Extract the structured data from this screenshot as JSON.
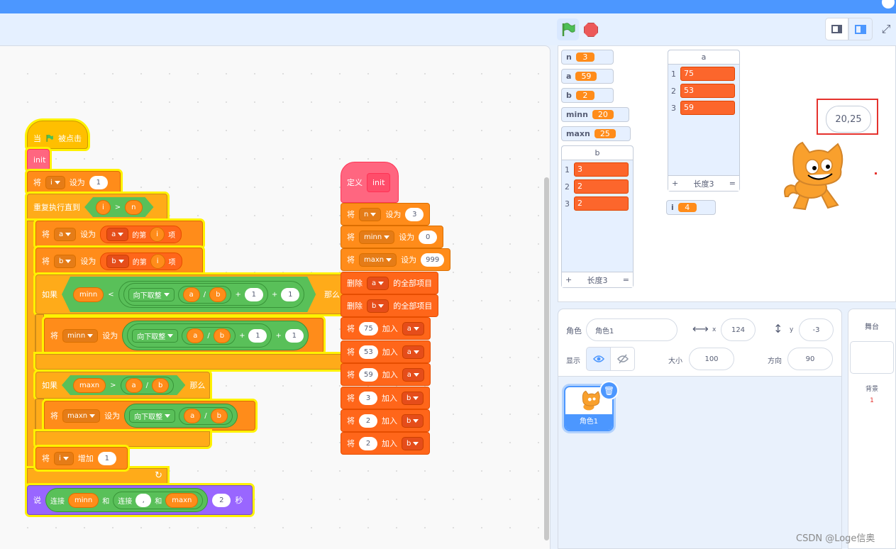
{
  "controls": {
    "green_flag": "green-flag-icon",
    "stop": "stop-icon"
  },
  "colors": {
    "accent": "#4c97ff",
    "events": "#ffbf00",
    "control": "#ffab19",
    "variables": "#ff8c1a",
    "lists": "#ff661a",
    "operators": "#59c059",
    "custom": "#ff6680",
    "looks": "#9966ff"
  },
  "script_main": {
    "hat": {
      "when": "当",
      "clicked": "被点击"
    },
    "init_call": "init",
    "set_i": {
      "verb": "将",
      "var": "i",
      "to": "设为",
      "value": "1"
    },
    "repeat": {
      "label": "重复执行直到",
      "left": "i",
      "op": ">",
      "right": "n"
    },
    "set_a": {
      "verb": "将",
      "var": "a",
      "to": "设为",
      "list": "a",
      "item_of": "的第",
      "index": "i",
      "item": "项"
    },
    "set_b": {
      "verb": "将",
      "var": "b",
      "to": "设为",
      "list": "b",
      "item_of": "的第",
      "index": "i",
      "item": "项"
    },
    "if1": {
      "label": "如果",
      "left": "minn",
      "op": "<",
      "floor": "向下取整",
      "a": "a",
      "div": "/",
      "b": "b",
      "plus1": "+",
      "one1": "1",
      "plus2": "+",
      "one2": "1",
      "then": "那么"
    },
    "set_minn": {
      "verb": "将",
      "var": "minn",
      "to": "设为",
      "floor": "向下取整",
      "a": "a",
      "div": "/",
      "b": "b",
      "plus1": "+",
      "one1": "1",
      "plus2": "+",
      "one2": "1"
    },
    "if2": {
      "label": "如果",
      "left": "maxn",
      "op": ">",
      "a": "a",
      "div": "/",
      "b": "b",
      "then": "那么"
    },
    "set_maxn": {
      "verb": "将",
      "var": "maxn",
      "to": "设为",
      "floor": "向下取整",
      "a": "a",
      "div": "/",
      "b": "b"
    },
    "change_i": {
      "verb": "将",
      "var": "i",
      "by": "增加",
      "value": "1"
    },
    "say": {
      "label": "说",
      "join1": "连接",
      "minn": "minn",
      "and1": "和",
      "join2": "连接",
      "comma": ",",
      "and2": "和",
      "maxn": "maxn",
      "secs": "2",
      "unit": "秒"
    }
  },
  "script_init": {
    "define": "定义",
    "name": "init",
    "rows": [
      {
        "verb": "将",
        "var": "n",
        "to": "设为",
        "value": "3"
      },
      {
        "verb": "将",
        "var": "minn",
        "to": "设为",
        "value": "0"
      },
      {
        "verb": "将",
        "var": "maxn",
        "to": "设为",
        "value": "999"
      },
      {
        "verb": "删除",
        "list": "a",
        "suffix": "的全部项目"
      },
      {
        "verb": "删除",
        "list": "b",
        "suffix": "的全部项目"
      },
      {
        "verb": "将",
        "value": "75",
        "add": "加入",
        "list": "a"
      },
      {
        "verb": "将",
        "value": "53",
        "add": "加入",
        "list": "a"
      },
      {
        "verb": "将",
        "value": "59",
        "add": "加入",
        "list": "a"
      },
      {
        "verb": "将",
        "value": "3",
        "add": "加入",
        "list": "b"
      },
      {
        "verb": "将",
        "value": "2",
        "add": "加入",
        "list": "b"
      },
      {
        "verb": "将",
        "value": "2",
        "add": "加入",
        "list": "b"
      }
    ]
  },
  "stage": {
    "monitors": [
      {
        "name": "n",
        "value": "3"
      },
      {
        "name": "a",
        "value": "59"
      },
      {
        "name": "b",
        "value": "2"
      },
      {
        "name": "minn",
        "value": "20"
      },
      {
        "name": "maxn",
        "value": "25"
      },
      {
        "name": "i",
        "value": "4"
      }
    ],
    "list_a": {
      "title": "a",
      "items": [
        "75",
        "53",
        "59"
      ],
      "indices": [
        "1",
        "2",
        "3"
      ],
      "add": "+",
      "length": "长度3",
      "resize": "="
    },
    "list_b": {
      "title": "b",
      "items": [
        "3",
        "2",
        "2"
      ],
      "indices": [
        "1",
        "2",
        "3"
      ],
      "add": "+",
      "length": "长度3",
      "resize": "="
    },
    "speech": "20,25"
  },
  "sprite_info": {
    "sprite_label": "角色",
    "sprite_name": "角色1",
    "x_label": "x",
    "x_value": "124",
    "y_label": "y",
    "y_value": "-3",
    "show_label": "显示",
    "size_label": "大小",
    "size_value": "100",
    "direction_label": "方向",
    "direction_value": "90"
  },
  "sprite_list": [
    {
      "name": "角色1"
    }
  ],
  "stage_panel": {
    "title": "舞台",
    "backdrops_label": "背景",
    "backdrops_count": "1"
  },
  "watermark": "CSDN @Loge信奥"
}
